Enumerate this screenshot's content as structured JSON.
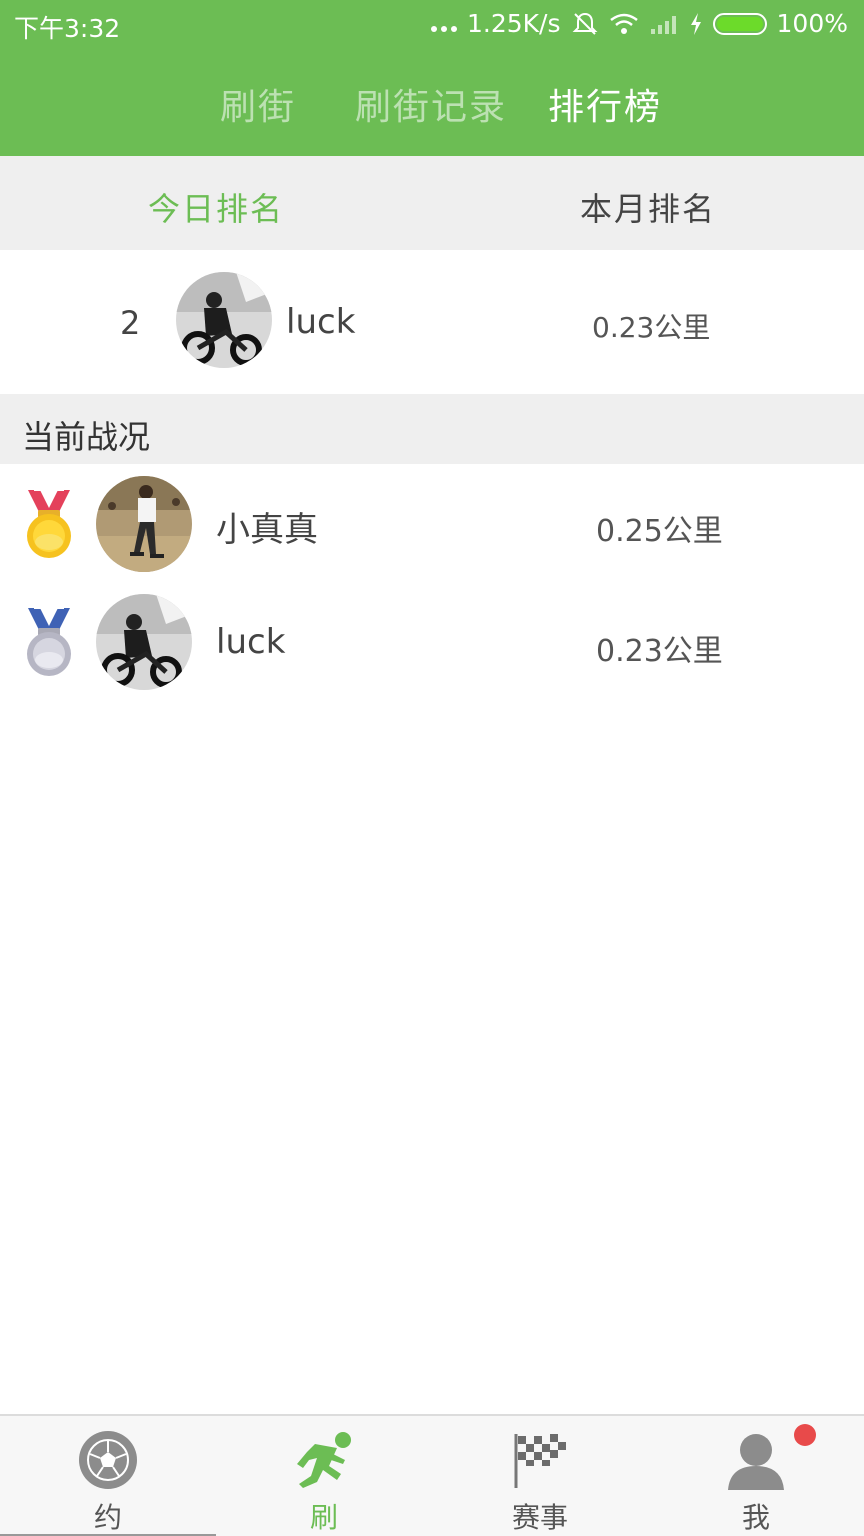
{
  "status": {
    "time": "下午3:32",
    "speed": "1.25K/s",
    "battery": "100%"
  },
  "header": {
    "tabs": [
      {
        "label": "刷街",
        "active": false
      },
      {
        "label": "刷街记录",
        "active": false
      },
      {
        "label": "排行榜",
        "active": true
      }
    ]
  },
  "subtabs": [
    {
      "label": "今日排名",
      "active": true
    },
    {
      "label": "本月排名",
      "active": false
    }
  ],
  "my_rank": {
    "rank": "2",
    "name": "luck",
    "distance": "0.23公里"
  },
  "section_title": "当前战况",
  "ranking": [
    {
      "medal": "gold-medal-icon",
      "name": "小真真",
      "distance": "0.25公里"
    },
    {
      "medal": "silver-medal-icon",
      "name": "luck",
      "distance": "0.23公里"
    }
  ],
  "bottom_nav": [
    {
      "label": "约",
      "icon": "soccer-ball-icon",
      "active": false
    },
    {
      "label": "刷",
      "icon": "runner-icon",
      "active": true
    },
    {
      "label": "赛事",
      "icon": "checkered-flag-icon",
      "active": false
    },
    {
      "label": "我",
      "icon": "user-icon",
      "active": false
    }
  ],
  "colors": {
    "brand": "#6cbd54",
    "badge": "#e84a4a"
  }
}
